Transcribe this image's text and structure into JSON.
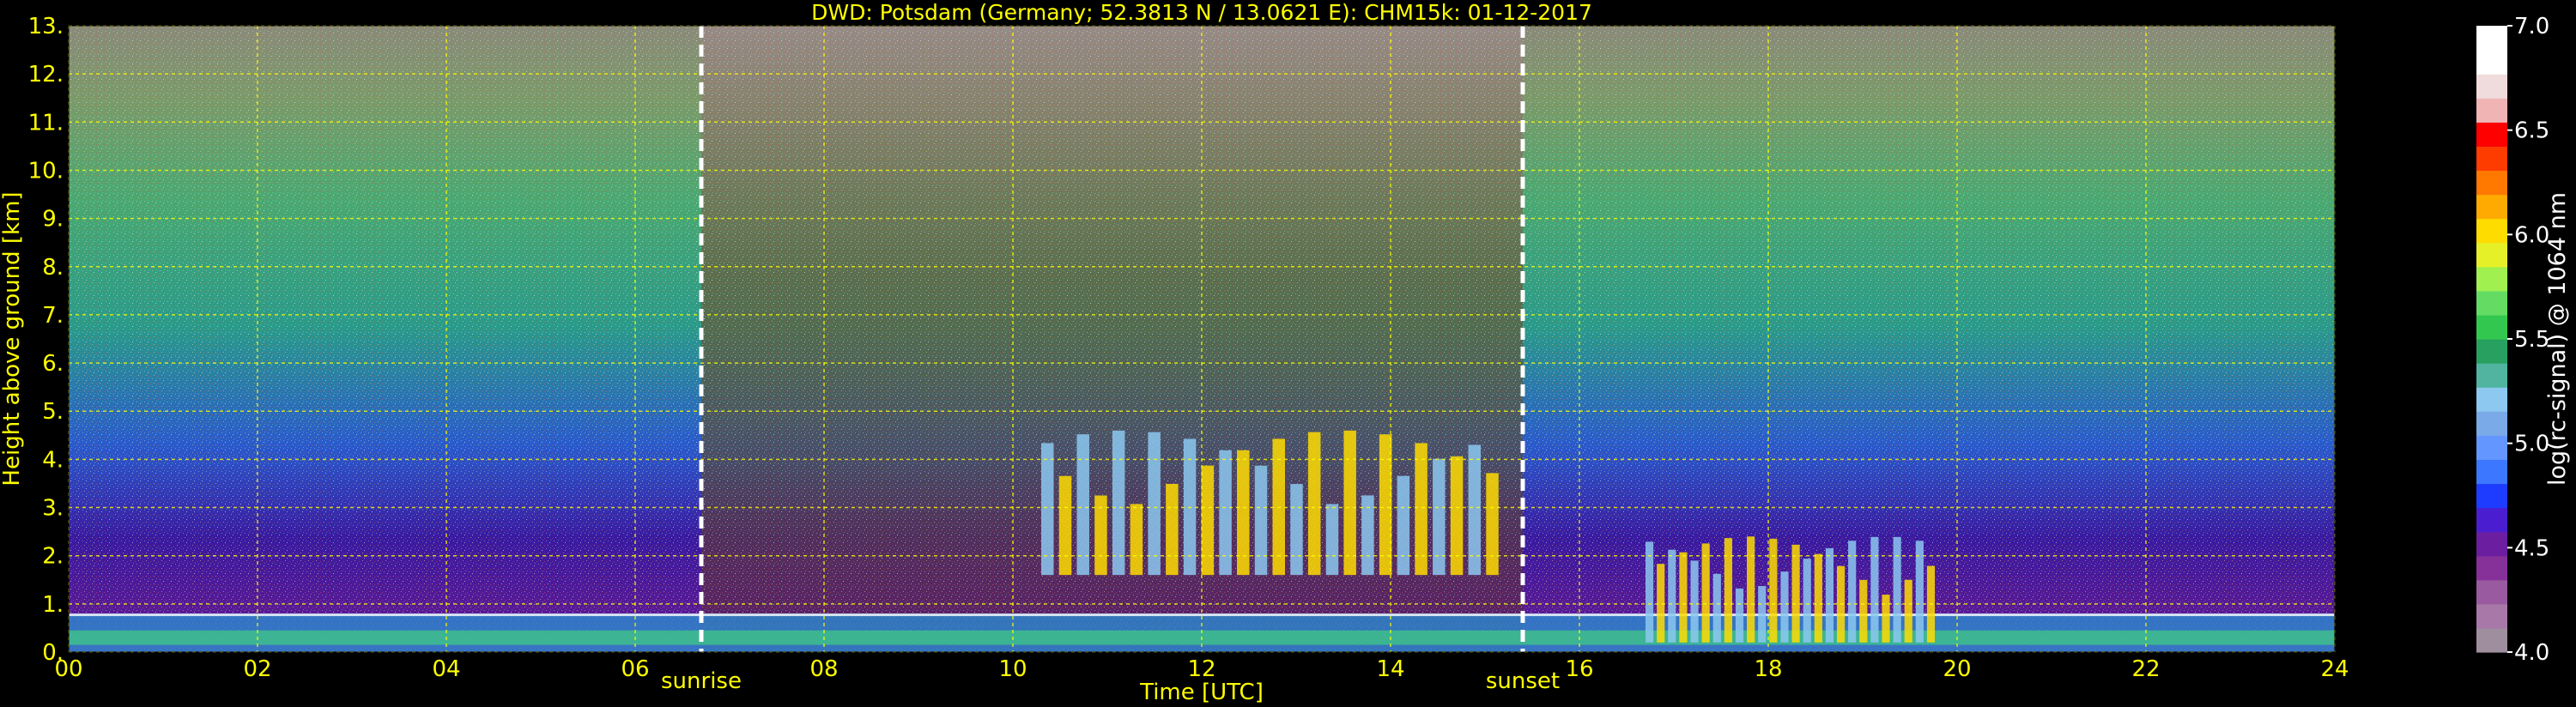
{
  "chart_data": {
    "type": "heatmap",
    "title": "DWD: Potsdam (Germany; 52.3813 N / 13.0621 E):    CHM15k: 01-12-2017",
    "xlabel": "Time [UTC]",
    "ylabel": "Height above ground [km]",
    "xlim": [
      0,
      24
    ],
    "ylim": [
      0,
      13
    ],
    "x_ticks": [
      0,
      2,
      4,
      6,
      8,
      10,
      12,
      14,
      16,
      18,
      20,
      22,
      24
    ],
    "x_tick_labels": [
      "00",
      "02",
      "04",
      "06",
      "08",
      "10",
      "12",
      "14",
      "16",
      "18",
      "20",
      "22",
      "24"
    ],
    "y_ticks": [
      0,
      1,
      2,
      3,
      4,
      5,
      6,
      7,
      8,
      9,
      10,
      11,
      12,
      13
    ],
    "y_tick_labels": [
      "0.",
      "1.",
      "2.",
      "3.",
      "4.",
      "5.",
      "6.",
      "7.",
      "8.",
      "9.",
      "10.",
      "11.",
      "12.",
      "13."
    ],
    "grid": true,
    "markers": [
      {
        "label": "sunrise",
        "time": 6.7
      },
      {
        "label": "sunset",
        "time": 15.4
      }
    ],
    "colorbar": {
      "label": "log(rc-signal) @ 1064 nm",
      "range": [
        4.0,
        7.0
      ],
      "ticks": [
        4.0,
        4.5,
        5.0,
        5.5,
        6.0,
        6.5,
        7.0
      ],
      "tick_labels": [
        "4.0",
        "4.5",
        "5.0",
        "5.5",
        "6.0",
        "6.5",
        "7.0"
      ],
      "colors": [
        "#9e8e9e",
        "#a878a8",
        "#9a5aa0",
        "#86309a",
        "#6b1ea0",
        "#4a1ed0",
        "#1e3cff",
        "#3c78ff",
        "#6496ff",
        "#7aaae8",
        "#8cc8f0",
        "#50b4a0",
        "#28a060",
        "#32c850",
        "#64dc64",
        "#a0f050",
        "#e6f028",
        "#ffdc00",
        "#ffaa00",
        "#ff7800",
        "#ff3c00",
        "#ff0000",
        "#f0b4b4",
        "#f0dcdc",
        "#ffffff",
        "#ffffff"
      ]
    },
    "features": [
      {
        "name": "boundary layer aerosol",
        "t0": 0,
        "t1": 24,
        "h0": 0.0,
        "h1": 0.8
      },
      {
        "name": "clouds",
        "t0": 10.3,
        "t1": 15.2,
        "h0": 1.6,
        "h1": 4.6
      },
      {
        "name": "low clouds",
        "t0": 16.7,
        "t1": 19.8,
        "h0": 0.2,
        "h1": 2.4
      }
    ]
  },
  "colors": {
    "text": "#ffff00",
    "colorbar_text": "#ffffff",
    "grid": "#ffff00",
    "background": "#000000"
  }
}
